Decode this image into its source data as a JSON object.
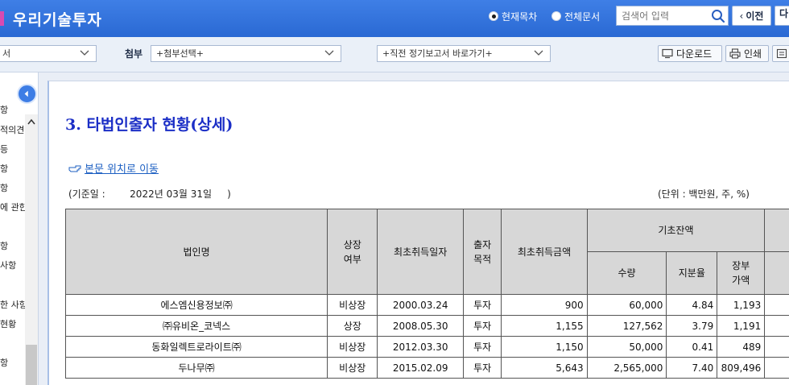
{
  "header": {
    "title": "우리기술투자",
    "radio_current": "현재목차",
    "radio_all": "전체문서",
    "search_placeholder": "검색어 입력",
    "prev_label": "이전",
    "next_label": "다"
  },
  "toolbar": {
    "doc_select_text": "서",
    "attach_label": "첨부",
    "attach_select_text": "+첨부선택+",
    "report_select_text": "+직전 정기보고서 바로가기+",
    "download_label": "다운로드",
    "print_label": "인쇄"
  },
  "sidebar": {
    "items": [
      "항",
      "적의견",
      "등",
      "항",
      "항",
      "에 관한",
      "항",
      "사항",
      "한 사항",
      "현황",
      "항"
    ]
  },
  "content": {
    "section_title": "3. 타법인출자 현황(상세)",
    "location_link": "본문 위치로 이동",
    "base_date": "(기준일 :        2022년 03월 31일     )",
    "unit": "(단위 : 백만원, 주, %)",
    "table": {
      "headers": {
        "corp_name": "법인명",
        "listing_line1": "상장",
        "listing_line2": "여부",
        "first_acq_date": "최초취득일자",
        "purpose_line1": "출자",
        "purpose_line2": "목적",
        "first_acq_amount": "최초취득금액",
        "opening_balance": "기초잔액",
        "qty": "수량",
        "share_ratio": "지분율",
        "book_line1": "장부",
        "book_line2": "가액"
      },
      "rows": [
        {
          "name": "에스엠신용정보㈜",
          "listing": "비상장",
          "date": "2000.03.24",
          "purpose": "투자",
          "amount": "900",
          "qty": "60,000",
          "ratio": "4.84",
          "book": "1,193"
        },
        {
          "name": "㈜유비온_코넥스",
          "listing": "상장",
          "date": "2008.05.30",
          "purpose": "투자",
          "amount": "1,155",
          "qty": "127,562",
          "ratio": "3.79",
          "book": "1,191"
        },
        {
          "name": "동화일렉트로라이트㈜",
          "listing": "비상장",
          "date": "2012.03.30",
          "purpose": "투자",
          "amount": "1,150",
          "qty": "50,000",
          "ratio": "0.41",
          "book": "489"
        },
        {
          "name": "두나무㈜",
          "listing": "비상장",
          "date": "2015.02.09",
          "purpose": "투자",
          "amount": "5,643",
          "qty": "2,565,000",
          "ratio": "7.40",
          "book": "809,496"
        }
      ]
    }
  }
}
